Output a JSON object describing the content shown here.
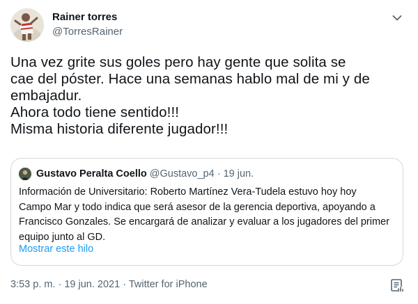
{
  "user": {
    "name": "Rainer torres",
    "handle": "@TorresRainer"
  },
  "tweet": {
    "lines": [
      "Una vez grite sus goles pero hay gente que solita se",
      "cae del póster. Hace una semanas hablo mal de mi y de",
      "embajadur.",
      "Ahora todo tiene sentido!!!",
      "Misma historia diferente jugador!!!"
    ]
  },
  "quoted": {
    "name": "Gustavo Peralta Coello",
    "meta": " @Gustavo_p4 · 19 jun.",
    "lines": [
      "Información de Universitario: Roberto Martínez Vera-Tudela estuvo hoy hoy",
      "Campo Mar y todo indica que será asesor de la gerencia deportiva, apoyando a",
      "Francisco Gonzales. Se encargará de analizar y evaluar a los jugadores del primer",
      "equipo junto al GD."
    ],
    "show_thread": "Mostrar este hilo"
  },
  "footer": {
    "timestamp": "3:53 p. m. · 19 jun. 2021 · ",
    "source": "Twitter for iPhone"
  },
  "icons": {
    "more": "chevron-down-icon",
    "analytics": "analytics-icon"
  },
  "colors": {
    "text": "#0f1419",
    "secondary": "#536471",
    "link": "#1d9bf0",
    "border": "#cfd9de"
  }
}
